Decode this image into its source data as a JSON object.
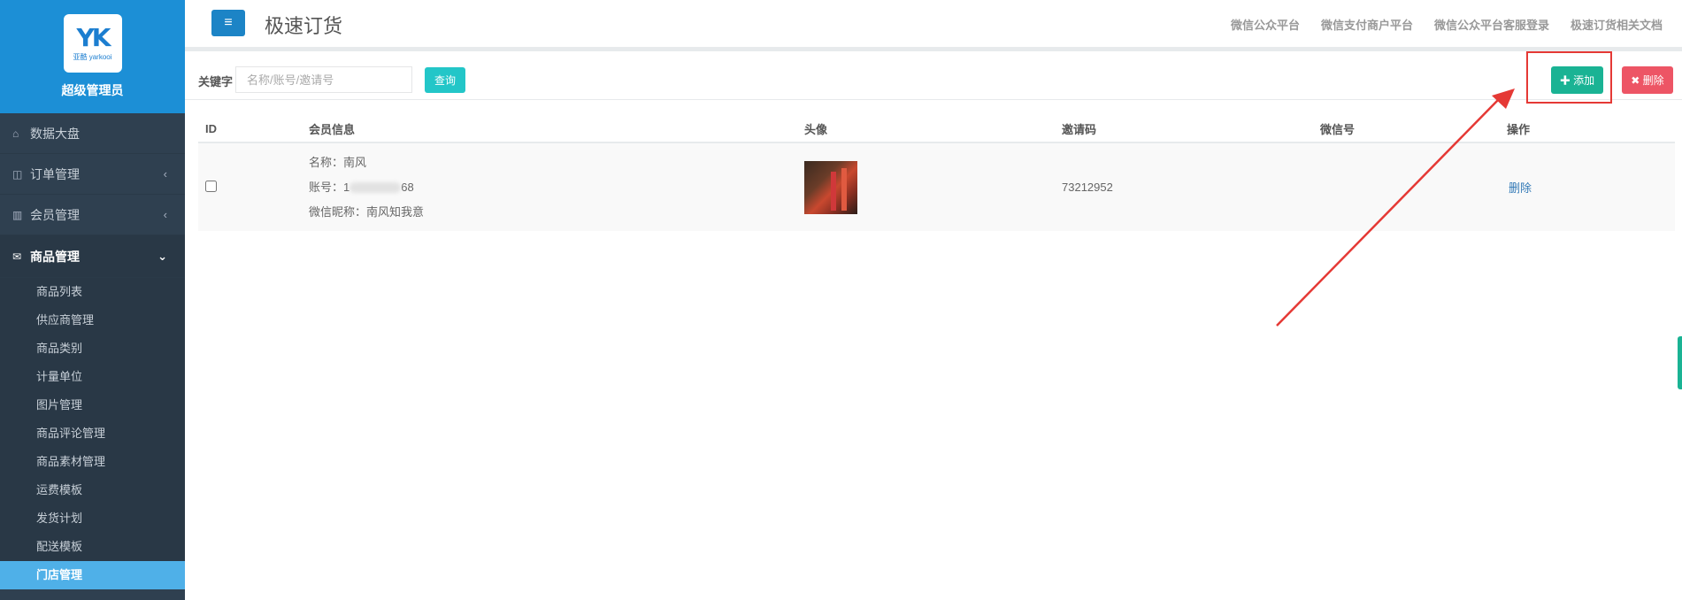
{
  "sidebar": {
    "logo_mark": "YK",
    "logo_sub": "亚酷 yarkooi",
    "role": "超级管理员",
    "items": [
      {
        "label": "数据大盘",
        "icon": "home-icon",
        "icon_glyph": "⌂",
        "arrow": ""
      },
      {
        "label": "订单管理",
        "icon": "columns-icon",
        "icon_glyph": "◫",
        "arrow": "‹"
      },
      {
        "label": "会员管理",
        "icon": "bar-chart-icon",
        "icon_glyph": "▥",
        "arrow": "‹"
      },
      {
        "label": "商品管理",
        "icon": "envelope-icon",
        "icon_glyph": "✉",
        "arrow": "⌄"
      }
    ],
    "subitems": [
      "商品列表",
      "供应商管理",
      "商品类别",
      "计量单位",
      "图片管理",
      "商品评论管理",
      "商品素材管理",
      "运费模板",
      "发货计划",
      "配送模板",
      "门店管理"
    ],
    "active_subitem": "门店管理"
  },
  "header": {
    "toggle_glyph": "≡",
    "title": "极速订货",
    "links": [
      "微信公众平台",
      "微信支付商户平台",
      "微信公众平台客服登录",
      "极速订货相关文档"
    ]
  },
  "toolbar": {
    "keyword_label": "关键字",
    "search_placeholder": "名称/账号/邀请号",
    "query_label": "查询",
    "add_label": "✚ 添加",
    "delete_label": "✖ 删除"
  },
  "table": {
    "headers": [
      "ID",
      "会员信息",
      "头像",
      "邀请码",
      "微信号",
      "操作"
    ],
    "rows": [
      {
        "name_line": "名称：南风",
        "account_prefix": "账号：1",
        "account_suffix": "68",
        "nickname_line": "微信昵称：南风知我意",
        "invite_code": "73212952",
        "wechat": "",
        "action": "删除"
      }
    ]
  },
  "colors": {
    "sidebar_bg": "#2f4050",
    "brand_blue": "#1c8fd6",
    "active_sub": "#4fb0e8",
    "add_green": "#1ab394",
    "delete_red": "#ed5565",
    "query_cyan": "#23c6c8",
    "annotation_red": "#e53935"
  }
}
